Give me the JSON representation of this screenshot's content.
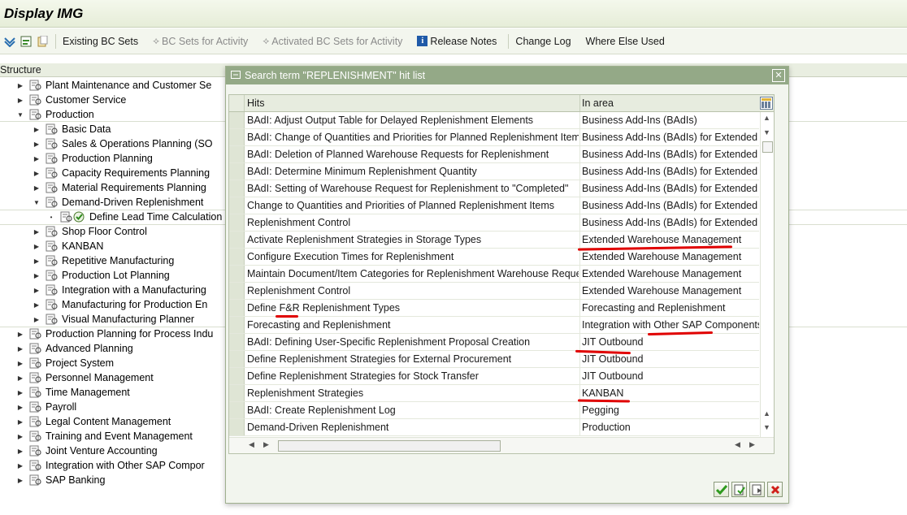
{
  "window": {
    "title": "Display IMG"
  },
  "toolbar": {
    "items": [
      {
        "label": "Existing BC Sets",
        "icon": "",
        "enabled": true
      },
      {
        "label": "BC Sets for Activity",
        "icon": "bc-sets-icon",
        "enabled": false
      },
      {
        "label": "Activated BC Sets for Activity",
        "icon": "bc-sets-icon",
        "enabled": false
      },
      {
        "label": "Release Notes",
        "icon": "info-icon",
        "enabled": true
      },
      {
        "label": "Change Log",
        "icon": "",
        "enabled": true
      },
      {
        "label": "Where Else Used",
        "icon": "",
        "enabled": true
      }
    ]
  },
  "structure": {
    "header": "Structure",
    "nodes": [
      {
        "label": "Plant Maintenance and Customer Se",
        "level": 1,
        "expanded": false
      },
      {
        "label": "Customer Service",
        "level": 1,
        "expanded": false
      },
      {
        "label": "Production",
        "level": 1,
        "expanded": true
      },
      {
        "label": "Basic Data",
        "level": 2,
        "expanded": false
      },
      {
        "label": "Sales & Operations Planning (SO",
        "level": 2,
        "expanded": false
      },
      {
        "label": "Production Planning",
        "level": 2,
        "expanded": false
      },
      {
        "label": "Capacity Requirements Planning",
        "level": 2,
        "expanded": false
      },
      {
        "label": "Material Requirements Planning",
        "level": 2,
        "expanded": false
      },
      {
        "label": "Demand-Driven Replenishment",
        "level": 2,
        "expanded": true
      },
      {
        "label": "Define Lead Time Calculation",
        "level": 3,
        "expanded": false
      },
      {
        "label": "Shop Floor Control",
        "level": 2,
        "expanded": false
      },
      {
        "label": "KANBAN",
        "level": 2,
        "expanded": false
      },
      {
        "label": "Repetitive Manufacturing",
        "level": 2,
        "expanded": false
      },
      {
        "label": "Production Lot Planning",
        "level": 2,
        "expanded": false
      },
      {
        "label": "Integration with a Manufacturing",
        "level": 2,
        "expanded": false
      },
      {
        "label": "Manufacturing for Production En",
        "level": 2,
        "expanded": false
      },
      {
        "label": "Visual Manufacturing Planner",
        "level": 2,
        "expanded": false
      },
      {
        "label": "Production Planning for Process Indu",
        "level": 1,
        "expanded": false
      },
      {
        "label": "Advanced Planning",
        "level": 1,
        "expanded": false
      },
      {
        "label": "Project System",
        "level": 1,
        "expanded": false
      },
      {
        "label": "Personnel Management",
        "level": 1,
        "expanded": false
      },
      {
        "label": "Time Management",
        "level": 1,
        "expanded": false
      },
      {
        "label": "Payroll",
        "level": 1,
        "expanded": false
      },
      {
        "label": "Legal Content Management",
        "level": 1,
        "expanded": false
      },
      {
        "label": "Training and Event Management",
        "level": 1,
        "expanded": false
      },
      {
        "label": "Joint Venture Accounting",
        "level": 1,
        "expanded": false
      },
      {
        "label": "Integration with Other SAP Compor",
        "level": 1,
        "expanded": false
      },
      {
        "label": "SAP Banking",
        "level": 1,
        "expanded": false
      }
    ]
  },
  "dialog": {
    "title": "Search term \"REPLENISHMENT\" hit list",
    "columns": {
      "hits": "Hits",
      "area": "In area"
    },
    "rows": [
      {
        "hit": "BAdI: Adjust Output Table for Delayed Replenishment Elements",
        "area": "Business Add-Ins (BAdIs)"
      },
      {
        "hit": "BAdI: Change of Quantities and Priorities for Planned Replenishment Items",
        "area": "Business Add-Ins (BAdIs) for Extended Warehouse Management"
      },
      {
        "hit": "BAdI: Deletion of Planned Warehouse Requests for Replenishment",
        "area": "Business Add-Ins (BAdIs) for Extended Warehouse Management"
      },
      {
        "hit": "BAdI: Determine Minimum Replenishment Quantity",
        "area": "Business Add-Ins (BAdIs) for Extended Warehouse Management"
      },
      {
        "hit": "BAdI: Setting of Warehouse Request for Replenishment to \"Completed\"",
        "area": "Business Add-Ins (BAdIs) for Extended Warehouse Management"
      },
      {
        "hit": "Change to Quantities and Priorities of Planned Replenishment Items",
        "area": "Business Add-Ins (BAdIs) for Extended Warehouse Management"
      },
      {
        "hit": "Replenishment Control",
        "area": "Business Add-Ins (BAdIs) for Extended Warehouse Management"
      },
      {
        "hit": "Activate Replenishment Strategies in Storage Types",
        "area": "Extended Warehouse Management"
      },
      {
        "hit": "Configure Execution Times for Replenishment",
        "area": "Extended Warehouse Management"
      },
      {
        "hit": "Maintain Document/Item Categories for Replenishment Warehouse Reque…",
        "area": "Extended Warehouse Management"
      },
      {
        "hit": "Replenishment Control",
        "area": "Extended Warehouse Management"
      },
      {
        "hit": "Define F&R Replenishment Types",
        "area": "Forecasting and Replenishment"
      },
      {
        "hit": "Forecasting and Replenishment",
        "area": "Integration with Other SAP Components"
      },
      {
        "hit": "BAdI: Defining User-Specific Replenishment Proposal Creation",
        "area": "JIT Outbound"
      },
      {
        "hit": "Define Replenishment Strategies for External Procurement",
        "area": "JIT Outbound"
      },
      {
        "hit": "Define Replenishment Strategies for Stock Transfer",
        "area": "JIT Outbound"
      },
      {
        "hit": "Replenishment Strategies",
        "area": "KANBAN"
      },
      {
        "hit": "BAdI: Create Replenishment Log",
        "area": "Pegging"
      },
      {
        "hit": "Demand-Driven Replenishment",
        "area": "Production"
      }
    ],
    "footer_buttons": [
      "continue",
      "choose",
      "find-next",
      "cancel"
    ]
  },
  "colors": {
    "dialog_title_bg": "#94a987",
    "annotation": "#e00000"
  }
}
